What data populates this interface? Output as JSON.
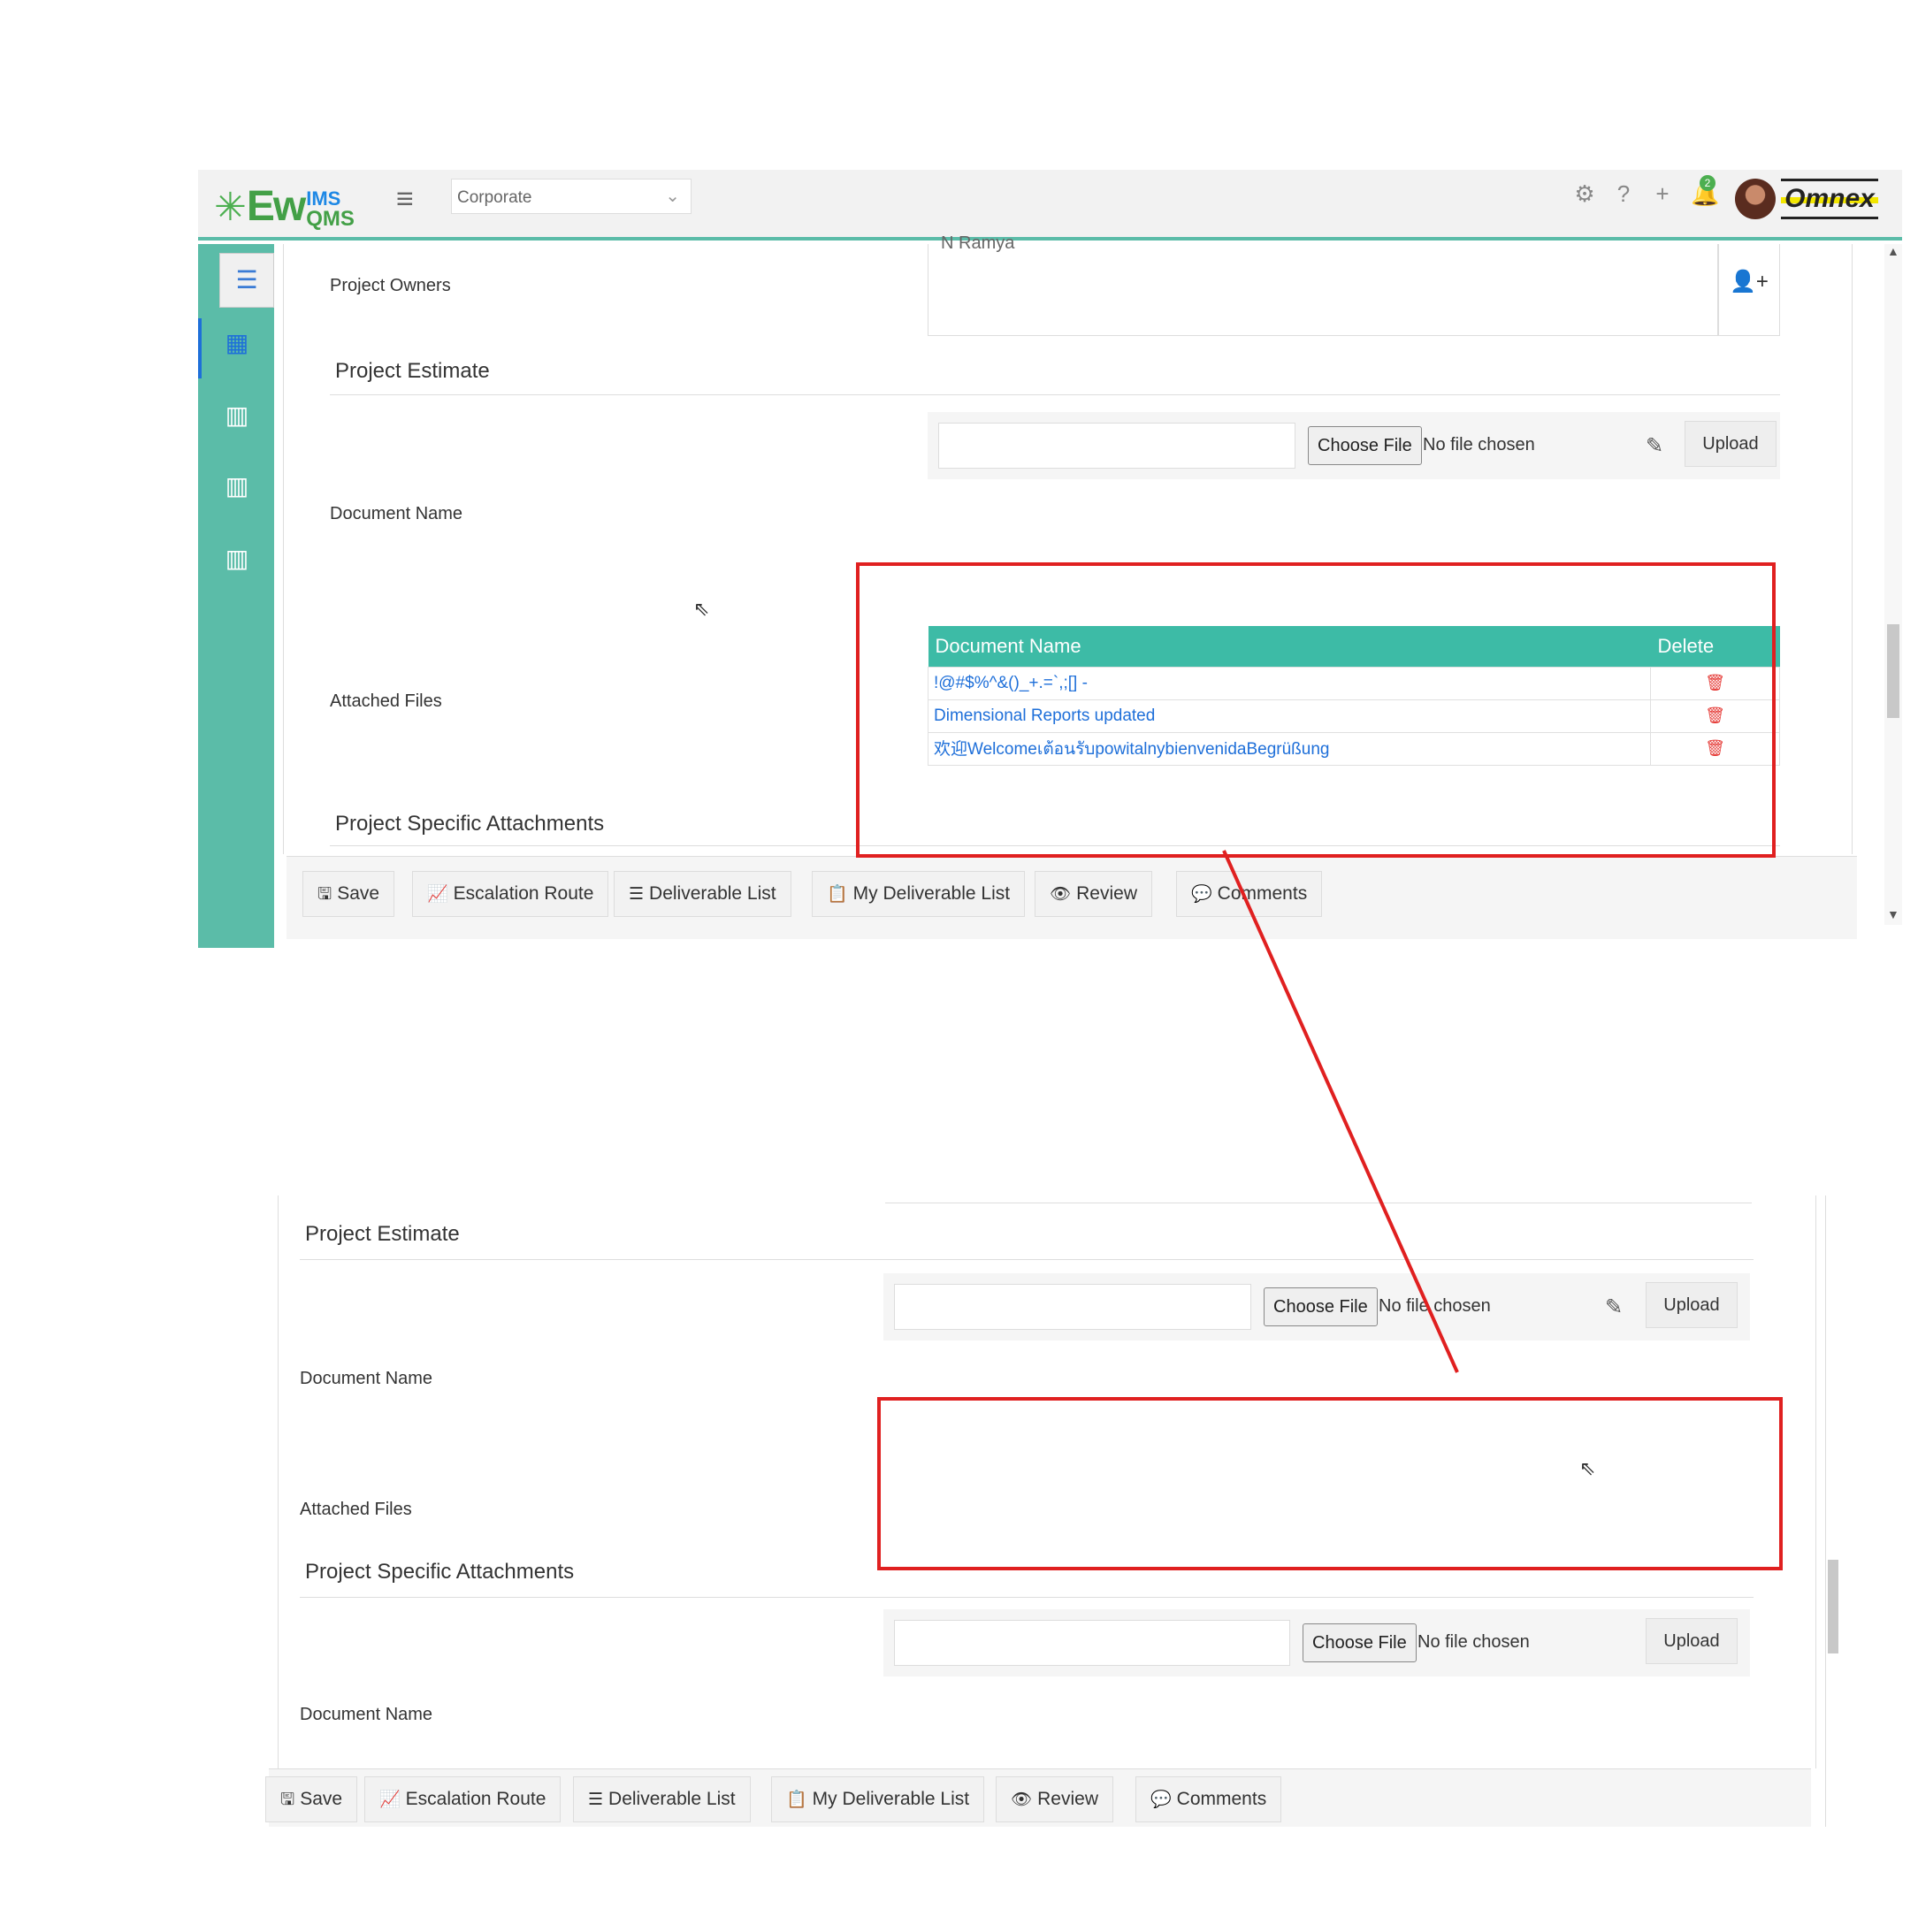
{
  "top": {
    "logo": {
      "main": "Ew",
      "sup": "IMS",
      "sub": "QMS"
    },
    "org_select": "Corporate",
    "notif_count": "2",
    "brand": "Omnex",
    "project_owners_label": "Project Owners",
    "owners_value": "N Ramya",
    "section_estimate": "Project Estimate",
    "doc_name_label": "Document Name",
    "choose_file": "Choose File",
    "no_file": "No file chosen",
    "upload": "Upload",
    "attached_files_label": "Attached Files",
    "table_headers": {
      "name": "Document Name",
      "delete": "Delete"
    },
    "files": [
      {
        "name": "!@#$%^&()_+.=`,;[] -"
      },
      {
        "name": "Dimensional Reports updated"
      },
      {
        "name": "欢迎Welcomeเต้อนรับpowitalnybienvenidaBegrüßung"
      }
    ],
    "section_specific": "Project Specific Attachments"
  },
  "footer": {
    "save": "Save",
    "escalation": "Escalation Route",
    "deliverable": "Deliverable List",
    "my_deliverable": "My Deliverable List",
    "review": "Review",
    "comments": "Comments"
  },
  "bottom": {
    "section_estimate": "Project Estimate",
    "doc_name_label": "Document Name",
    "choose_file": "Choose File",
    "no_file": "No file chosen",
    "upload": "Upload",
    "attached_files_label": "Attached Files",
    "section_specific": "Project Specific Attachments",
    "doc_name_label_2": "Document Name"
  },
  "colors": {
    "accent": "#5bbca8",
    "table_header": "#3dbba6",
    "annotation": "#e02020",
    "link": "#1e6fd9",
    "delete": "#e53935"
  },
  "icons": [
    "hamburger-icon",
    "gear-icon",
    "help-icon",
    "plus-icon",
    "bell-icon",
    "building-icon",
    "add-user-icon",
    "edit-icon",
    "trash-icon",
    "save-icon",
    "chart-icon",
    "list-icon",
    "clipboard-icon",
    "eye-icon",
    "comment-icon"
  ]
}
